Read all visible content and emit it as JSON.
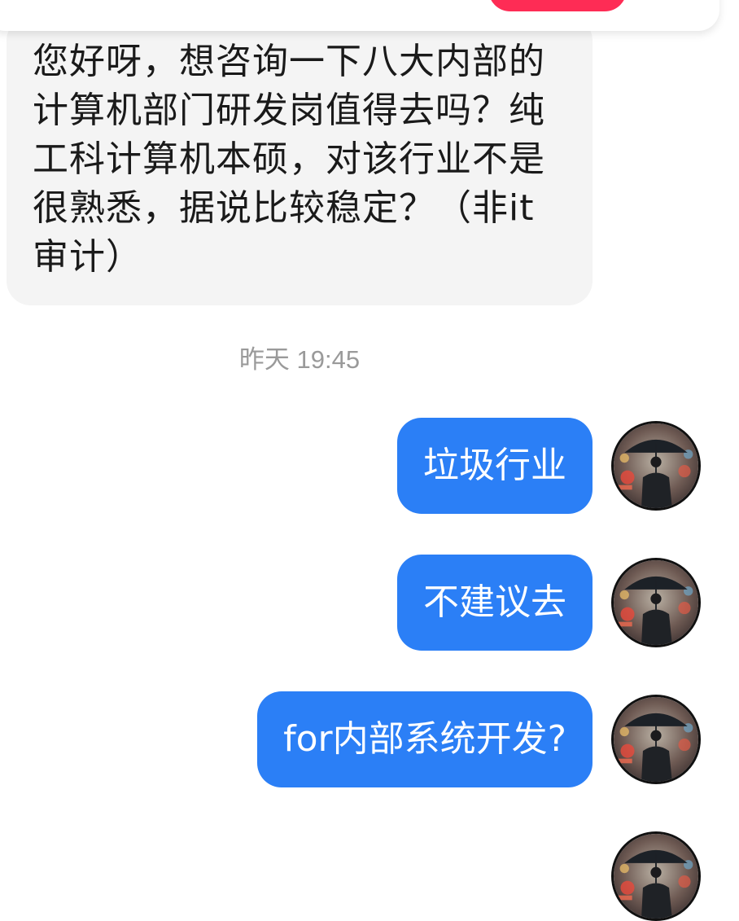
{
  "incoming_message": {
    "text": "您好呀，想咨询一下八大内部的计算机部门研发岗值得去吗？纯工科计算机本硕，对该行业不是很熟悉，据说比较稳定？（非it审计）"
  },
  "timestamp": "昨天 19:45",
  "outgoing_messages": [
    {
      "text": "垃圾行业"
    },
    {
      "text": "不建议去"
    },
    {
      "text": "for内部系统开发?"
    }
  ],
  "colors": {
    "outgoing_bubble": "#2b7ff6",
    "incoming_bubble": "#f4f4f4",
    "timestamp": "#9a9a9a",
    "top_button": "#fe2c55"
  },
  "icons": {
    "avatar": "user-avatar-umbrella-man"
  }
}
